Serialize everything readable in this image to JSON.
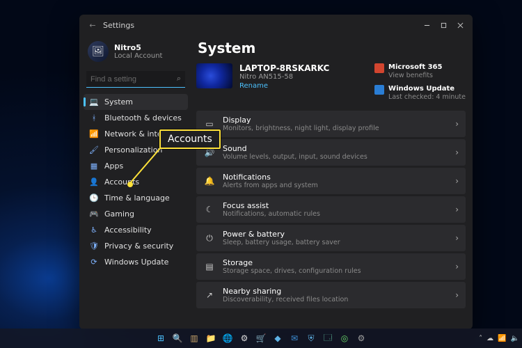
{
  "window": {
    "title": "Settings",
    "controls": {
      "min": "–",
      "max": "▢",
      "close": "✕"
    }
  },
  "user": {
    "name": "Nitro5",
    "subtitle": "Local Account"
  },
  "search": {
    "placeholder": "Find a setting"
  },
  "nav": [
    {
      "icon": "💻",
      "label": "System",
      "active": true
    },
    {
      "icon": "ᚼ",
      "label": "Bluetooth & devices"
    },
    {
      "icon": "📶",
      "label": "Network & internet"
    },
    {
      "icon": "🖌",
      "label": "Personalization"
    },
    {
      "icon": "▦",
      "label": "Apps"
    },
    {
      "icon": "👤",
      "label": "Accounts"
    },
    {
      "icon": "🕒",
      "label": "Time & language"
    },
    {
      "icon": "🎮",
      "label": "Gaming"
    },
    {
      "icon": "♿",
      "label": "Accessibility"
    },
    {
      "icon": "🛡",
      "label": "Privacy & security"
    },
    {
      "icon": "⟳",
      "label": "Windows Update"
    }
  ],
  "page": {
    "title": "System",
    "device": {
      "name": "LAPTOP-8RSKARKC",
      "model": "Nitro AN515-58",
      "rename": "Rename"
    },
    "promo": [
      {
        "name": "Microsoft 365",
        "sub": "View benefits",
        "color": "#d2452f"
      },
      {
        "name": "Windows Update",
        "sub": "Last checked: 4 minute",
        "color": "#2a7dd4"
      }
    ],
    "categories": [
      {
        "icon": "▭",
        "title": "Display",
        "sub": "Monitors, brightness, night light, display profile"
      },
      {
        "icon": "🔊",
        "title": "Sound",
        "sub": "Volume levels, output, input, sound devices"
      },
      {
        "icon": "🔔",
        "title": "Notifications",
        "sub": "Alerts from apps and system"
      },
      {
        "icon": "☾",
        "title": "Focus assist",
        "sub": "Notifications, automatic rules"
      },
      {
        "icon": "⏻",
        "title": "Power & battery",
        "sub": "Sleep, battery usage, battery saver"
      },
      {
        "icon": "▤",
        "title": "Storage",
        "sub": "Storage space, drives, configuration rules"
      },
      {
        "icon": "↗",
        "title": "Nearby sharing",
        "sub": "Discoverability, received files location"
      }
    ]
  },
  "callout": {
    "label": "Accounts"
  },
  "taskbar": {
    "items": [
      {
        "g": "⊞",
        "c": "#4cc2ff"
      },
      {
        "g": "🔍",
        "c": "#ddd"
      },
      {
        "g": "▥",
        "c": "#c7a36a"
      },
      {
        "g": "📁",
        "c": "#e6c66a"
      },
      {
        "g": "🌐",
        "c": "#5099e0"
      },
      {
        "g": "⚙",
        "c": "#ddd"
      },
      {
        "g": "🛒",
        "c": "#5fb3e6"
      },
      {
        "g": "◆",
        "c": "#5fb3e6"
      },
      {
        "g": "✉",
        "c": "#3d8fd6"
      },
      {
        "g": "⛨",
        "c": "#5fb3e6"
      },
      {
        "g": "🗔",
        "c": "#6ad6b0"
      },
      {
        "g": "◎",
        "c": "#6ad66a"
      },
      {
        "g": "⚙",
        "c": "#a0a0a0"
      }
    ]
  }
}
